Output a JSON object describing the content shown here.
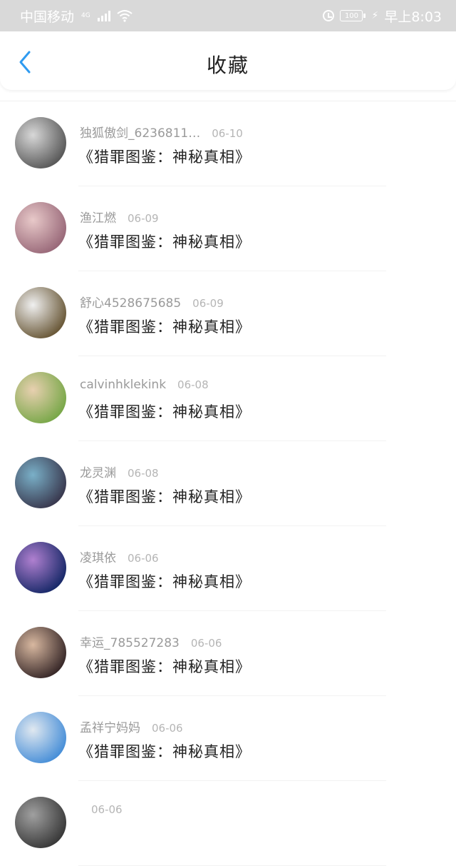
{
  "status_bar": {
    "carrier": "中国移动",
    "network": "4G",
    "battery": "100",
    "time": "早上8:03"
  },
  "header": {
    "title": "收藏",
    "back_icon": "chevron-left-icon",
    "accent_color": "#2f9bf0"
  },
  "items": [
    {
      "user": "独狐傲剑_6236811…",
      "date": "06-10",
      "title": "《猎罪图鉴：神秘真相》",
      "avatar_colors": [
        "#5a5a5a",
        "#d8d8d8"
      ]
    },
    {
      "user": "渔江燃",
      "date": "06-09",
      "title": "《猎罪图鉴：神秘真相》",
      "avatar_colors": [
        "#9a6a7a",
        "#e8c9c9"
      ]
    },
    {
      "user": "舒心4528675685",
      "date": "06-09",
      "title": "《猎罪图鉴：神秘真相》",
      "avatar_colors": [
        "#6b5a3a",
        "#f0f0f0"
      ]
    },
    {
      "user": "calvinhklekink",
      "date": "06-08",
      "title": "《猎罪图鉴：神秘真相》",
      "avatar_colors": [
        "#7aa84a",
        "#e8d0b0"
      ]
    },
    {
      "user": "龙灵渊",
      "date": "06-08",
      "title": "《猎罪图鉴：神秘真相》",
      "avatar_colors": [
        "#3a3a50",
        "#7ab0c8"
      ]
    },
    {
      "user": "凌琪依",
      "date": "06-06",
      "title": "《猎罪图鉴：神秘真相》",
      "avatar_colors": [
        "#1a2a6a",
        "#b080d0"
      ]
    },
    {
      "user": "幸运_785527283",
      "date": "06-06",
      "title": "《猎罪图鉴：神秘真相》",
      "avatar_colors": [
        "#3a2a2a",
        "#d8b8a0"
      ]
    },
    {
      "user": "孟祥宁妈妈",
      "date": "06-06",
      "title": "《猎罪图鉴：神秘真相》",
      "avatar_colors": [
        "#4a90d8",
        "#e0e8f0"
      ]
    },
    {
      "user": "",
      "date": "06-06",
      "title": "",
      "avatar_colors": [
        "#3a3a3a",
        "#a0a0a0"
      ]
    }
  ]
}
